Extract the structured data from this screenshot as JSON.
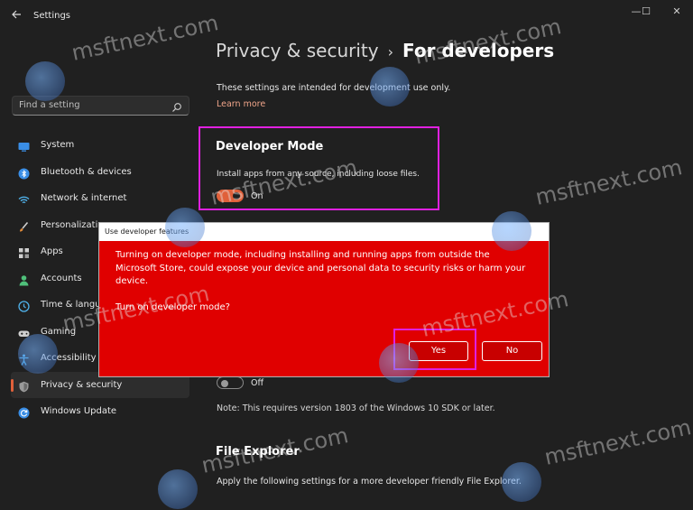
{
  "app": {
    "title": "Settings"
  },
  "window_controls": {
    "minimize": "—",
    "maximize": "☐",
    "close": "✕"
  },
  "search": {
    "placeholder": "Find a setting"
  },
  "sidebar": {
    "items": [
      {
        "label": "System",
        "icon": "monitor-icon",
        "color": "#3a8ee6"
      },
      {
        "label": "Bluetooth & devices",
        "icon": "bluetooth-icon",
        "color": "#3a8ee6"
      },
      {
        "label": "Network & internet",
        "icon": "wifi-icon",
        "color": "#4fb0e8"
      },
      {
        "label": "Personalization",
        "icon": "brush-icon",
        "color": "#e08a3a"
      },
      {
        "label": "Apps",
        "icon": "apps-icon",
        "color": "#cfcfcf"
      },
      {
        "label": "Accounts",
        "icon": "person-icon",
        "color": "#4fc07a"
      },
      {
        "label": "Time & language",
        "icon": "globe-clock-icon",
        "color": "#4fb0e8"
      },
      {
        "label": "Gaming",
        "icon": "gamepad-icon",
        "color": "#cfcfcf"
      },
      {
        "label": "Accessibility",
        "icon": "accessibility-icon",
        "color": "#4fb0e8"
      },
      {
        "label": "Privacy & security",
        "icon": "shield-icon",
        "color": "#9a9a9a",
        "selected": true
      },
      {
        "label": "Windows Update",
        "icon": "update-icon",
        "color": "#3a8ee6"
      }
    ]
  },
  "header": {
    "crumb": "Privacy & security",
    "separator": "›",
    "current": "For developers"
  },
  "main": {
    "intro": "These settings are intended for development use only.",
    "learn_more": "Learn more",
    "developer_mode": {
      "title": "Developer Mode",
      "description": "Install apps from any source, including loose files.",
      "toggle_state": "On"
    },
    "device_portal": {
      "toggle_state": "Off"
    },
    "note": "Note: This requires version 1803 of the Windows 10 SDK or later.",
    "file_explorer": {
      "title": "File Explorer",
      "description": "Apply the following settings for a more developer friendly File Explorer."
    }
  },
  "dialog": {
    "title": "Use developer features",
    "message": "Turning on developer mode, including installing and running apps from outside the Microsoft Store, could expose your device and personal data to security risks or harm your device.",
    "question": "Turn on developer mode?",
    "yes_label": "Yes",
    "no_label": "No"
  },
  "watermark": {
    "text": "msftnext.com"
  },
  "colors": {
    "accent": "#e0603a",
    "dialog_bg": "#e00000",
    "highlight": "#e020e0",
    "background": "#202020"
  }
}
